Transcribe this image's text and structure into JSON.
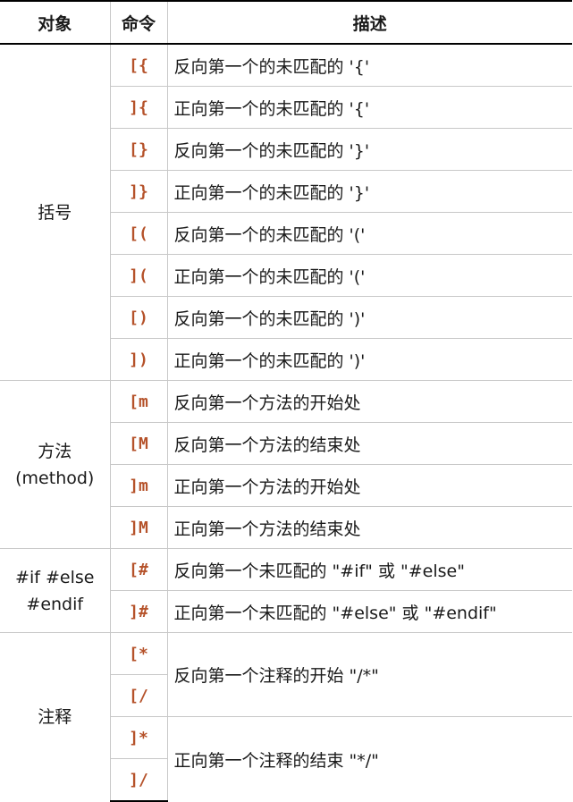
{
  "headers": {
    "object": "对象",
    "command": "命令",
    "description": "描述"
  },
  "groups": {
    "brackets": {
      "object": "括号",
      "rows": [
        {
          "cmd": "[{",
          "desc": "反向第一个的未匹配的 '{'"
        },
        {
          "cmd": "]{",
          "desc": "正向第一个的未匹配的 '{'"
        },
        {
          "cmd": "[}",
          "desc": "反向第一个的未匹配的 '}'"
        },
        {
          "cmd": "]}",
          "desc": "正向第一个的未匹配的 '}'"
        },
        {
          "cmd": "[(",
          "desc": "反向第一个的未匹配的 '('"
        },
        {
          "cmd": "](",
          "desc": "正向第一个的未匹配的 '('"
        },
        {
          "cmd": "[)",
          "desc": "反向第一个的未匹配的 ')'"
        },
        {
          "cmd": "])",
          "desc": "正向第一个的未匹配的 ')'"
        }
      ]
    },
    "method": {
      "object_line1": "方法",
      "object_line2": "(method)",
      "rows": [
        {
          "cmd": "[m",
          "desc": "反向第一个方法的开始处"
        },
        {
          "cmd": "[M",
          "desc": "反向第一个方法的结束处"
        },
        {
          "cmd": "]m",
          "desc": "正向第一个方法的开始处"
        },
        {
          "cmd": "]M",
          "desc": "正向第一个方法的结束处"
        }
      ]
    },
    "preproc": {
      "object_line1": "#if #else",
      "object_line2": "#endif",
      "rows": [
        {
          "cmd": "[#",
          "desc": "反向第一个未匹配的 \"#if\" 或 \"#else\""
        },
        {
          "cmd": "]#",
          "desc": "正向第一个未匹配的 \"#else\" 或 \"#endif\""
        }
      ]
    },
    "comment": {
      "object": "注释",
      "rows": [
        {
          "cmd": "[*"
        },
        {
          "cmd": "[/"
        },
        {
          "cmd": "]*"
        },
        {
          "cmd": "]/"
        }
      ],
      "desc_start": "反向第一个注释的开始 \"/*\"",
      "desc_end": "正向第一个注释的结束 \"*/\""
    }
  }
}
